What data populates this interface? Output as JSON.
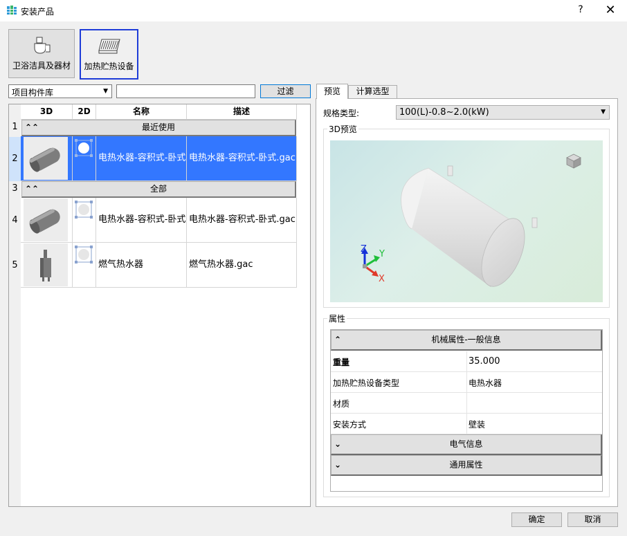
{
  "window": {
    "title": "安装产品",
    "help": "?",
    "close": "✕"
  },
  "categories": [
    {
      "label": "卫浴洁具及器材",
      "icon": "sanitary-icon",
      "selected": false
    },
    {
      "label": "加热贮热设备",
      "icon": "heater-icon",
      "selected": true
    }
  ],
  "filter": {
    "library": "项目构件库",
    "search_value": "",
    "filter_button": "过滤"
  },
  "grid": {
    "headers": [
      "3D",
      "2D",
      "名称",
      "描述"
    ],
    "rows": [
      {
        "num": "1",
        "type": "group",
        "label": "最近使用",
        "chev": "≈"
      },
      {
        "num": "2",
        "type": "item",
        "name": "电热水器-容积式-卧式",
        "desc": "电热水器-容积式-卧式.gac",
        "selected": true,
        "thumb": "horizontal-tank"
      },
      {
        "num": "3",
        "type": "group",
        "label": "全部",
        "chev": "≈"
      },
      {
        "num": "4",
        "type": "item",
        "name": "电热水器-容积式-卧式",
        "desc": "电热水器-容积式-卧式.gac",
        "selected": false,
        "thumb": "horizontal-tank"
      },
      {
        "num": "5",
        "type": "item",
        "name": "燃气热水器",
        "desc": "燃气热水器.gac",
        "selected": false,
        "thumb": "gas-heater"
      }
    ]
  },
  "tabs": [
    {
      "label": "预览",
      "active": true
    },
    {
      "label": "计算选型",
      "active": false
    }
  ],
  "preview": {
    "spec_label": "规格类型:",
    "spec_value": "100(L)-0.8~2.0(kW)",
    "group_3d": "3D预览",
    "axis_z": "Z",
    "axis_y": "Y",
    "axis_x": "X"
  },
  "properties": {
    "group_label": "属性",
    "sections": [
      {
        "title": "机械属性-一般信息",
        "expanded": true,
        "rows": [
          {
            "name": "重量",
            "value": "35.000"
          },
          {
            "name": "加热贮热设备类型",
            "value": "电热水器"
          },
          {
            "name": "材质",
            "value": ""
          },
          {
            "name": "安装方式",
            "value": "壁装"
          }
        ]
      },
      {
        "title": "电气信息",
        "expanded": false
      },
      {
        "title": "通用属性",
        "expanded": false
      }
    ]
  },
  "footer": {
    "ok": "确定",
    "cancel": "取消"
  },
  "colors": {
    "selection": "#3377ff",
    "accent": "#1e3cd8",
    "focus": "#0078d7"
  }
}
